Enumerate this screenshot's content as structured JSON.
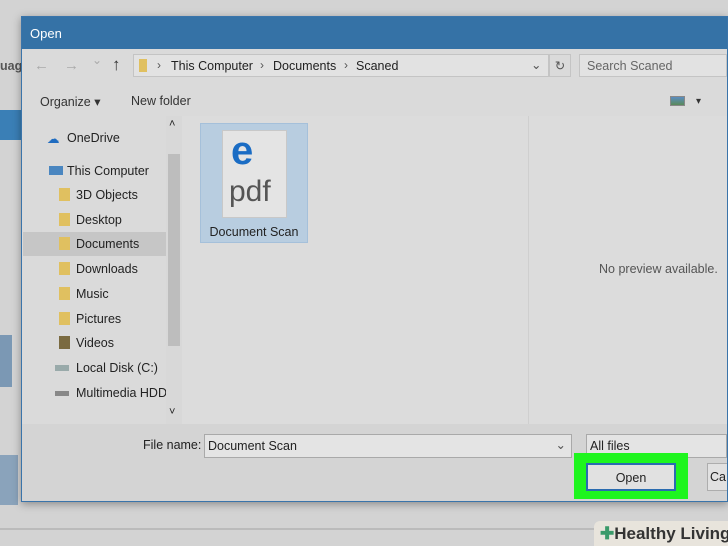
{
  "background_app": {
    "partial_text": "uag"
  },
  "dialog": {
    "title": "Open",
    "nav": {
      "back": "←",
      "forward": "→",
      "recent": "⌄",
      "up": "↑",
      "refresh": "↻"
    },
    "breadcrumb": [
      "This Computer",
      "Documents",
      "Scaned"
    ],
    "search_placeholder": "Search Scaned",
    "toolbar": {
      "organize": "Organize ▾",
      "new_folder": "New folder",
      "view_dropdown": "▾"
    },
    "nav_pane": {
      "items": [
        {
          "label": "OneDrive",
          "icon": "onedrive-icon"
        },
        {
          "label": "This Computer",
          "icon": "computer-icon"
        },
        {
          "label": "3D Objects",
          "icon": "folder-3d-icon"
        },
        {
          "label": "Desktop",
          "icon": "folder-desktop-icon"
        },
        {
          "label": "Documents",
          "icon": "folder-documents-icon",
          "selected": true
        },
        {
          "label": "Downloads",
          "icon": "folder-downloads-icon"
        },
        {
          "label": "Music",
          "icon": "folder-music-icon"
        },
        {
          "label": "Pictures",
          "icon": "folder-pictures-icon"
        },
        {
          "label": "Videos",
          "icon": "folder-videos-icon"
        },
        {
          "label": "Local Disk (C:)",
          "icon": "drive-icon"
        },
        {
          "label": "Multimedia HDD",
          "icon": "drive-icon"
        }
      ],
      "scroll_up": "˄",
      "scroll_down": "˅"
    },
    "files": [
      {
        "name": "Document Scan",
        "icon_text": "pdf",
        "icon_letter": "e"
      }
    ],
    "preview_text": "No preview available.",
    "file_name_label": "File name:",
    "file_name_value": "Document Scan",
    "file_type": "All files",
    "open_button": "Open",
    "cancel_button": "Ca"
  },
  "watermark": "Healthy Living",
  "colors": {
    "title": "#3572a6",
    "highlight": "#1ef51e",
    "selection": "#b8cde0"
  }
}
